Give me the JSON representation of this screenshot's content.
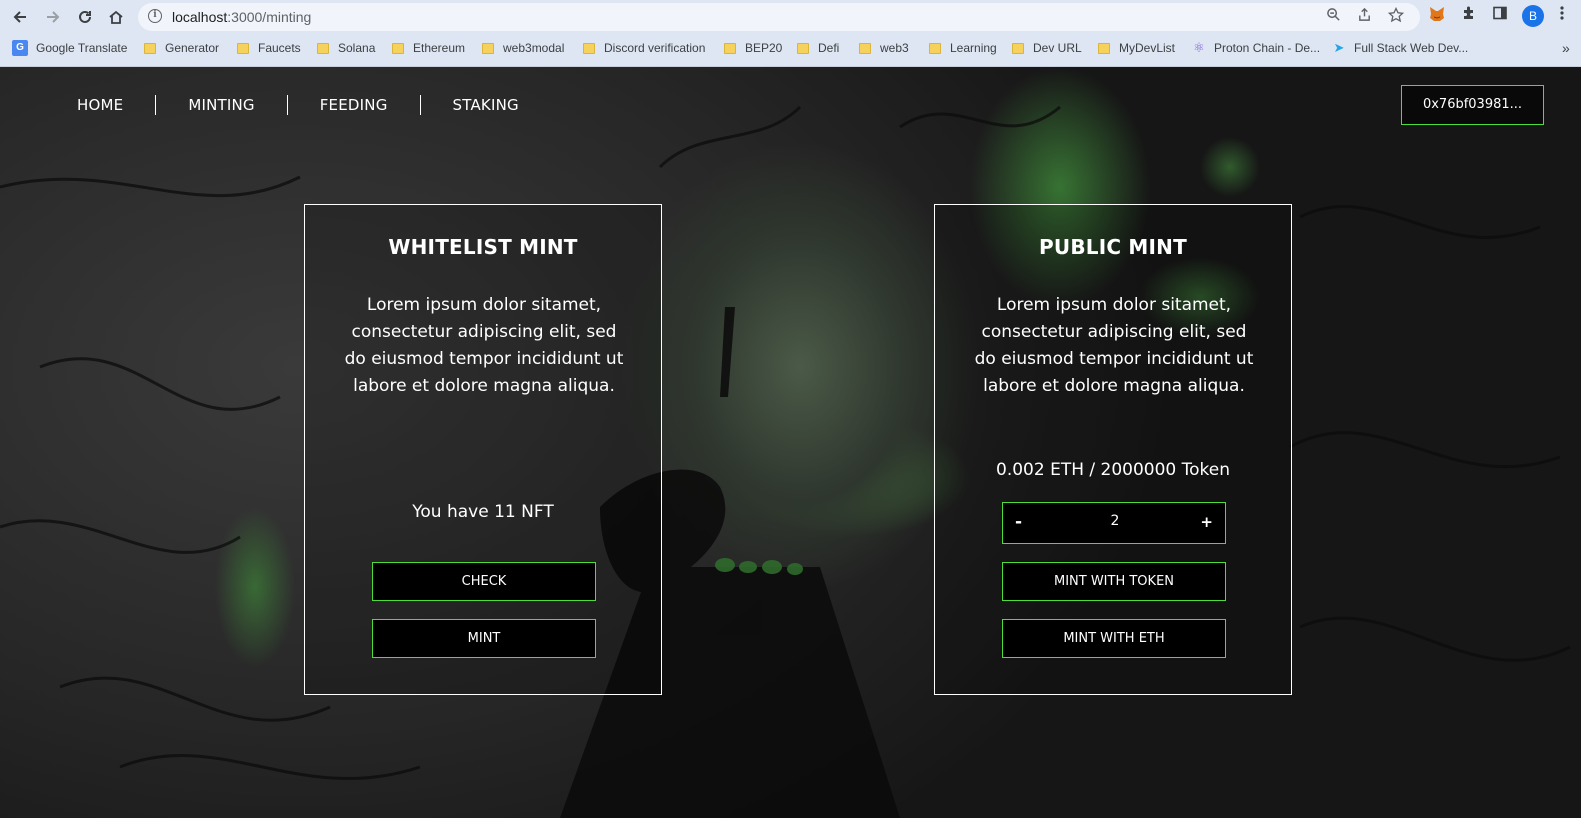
{
  "browser": {
    "url_host": "localhost",
    "url_path": ":3000/minting",
    "profile_initial": "B",
    "bookmarks": [
      {
        "label": "Google Translate",
        "icon": "google-translate-icon"
      },
      {
        "label": "Generator",
        "icon": "folder-icon"
      },
      {
        "label": "Faucets",
        "icon": "folder-icon"
      },
      {
        "label": "Solana",
        "icon": "folder-icon"
      },
      {
        "label": "Ethereum",
        "icon": "folder-icon"
      },
      {
        "label": "web3modal",
        "icon": "folder-icon"
      },
      {
        "label": "Discord verification",
        "icon": "folder-icon"
      },
      {
        "label": "BEP20",
        "icon": "folder-icon"
      },
      {
        "label": "Defi",
        "icon": "folder-icon"
      },
      {
        "label": "web3",
        "icon": "folder-icon"
      },
      {
        "label": "Learning",
        "icon": "folder-icon"
      },
      {
        "label": "Dev URL",
        "icon": "folder-icon"
      },
      {
        "label": "MyDevList",
        "icon": "folder-icon"
      },
      {
        "label": "Proton Chain - De...",
        "icon": "react-icon"
      },
      {
        "label": "Full Stack Web Dev...",
        "icon": "flutter-icon"
      }
    ],
    "overflow_label": "»"
  },
  "nav": {
    "items": [
      "HOME",
      "MINTING",
      "FEEDING",
      "STAKING"
    ]
  },
  "wallet": {
    "address_label": "0x76bf03981..."
  },
  "whitelist": {
    "title": "WHITELIST MINT",
    "description": "Lorem ipsum dolor sitamet, consectetur adipiscing elit, sed do eiusmod tempor incididunt ut labore et dolore magna aliqua.",
    "nft_status": "You have 11 NFT",
    "check_label": "CHECK",
    "mint_label": "MINT"
  },
  "public": {
    "title": "PUBLIC MINT",
    "description": "Lorem ipsum dolor sitamet, consectetur adipiscing elit, sed do eiusmod tempor incididunt ut labore et dolore magna aliqua.",
    "price": "0.002 ETH / 2000000 Token",
    "quantity": "2",
    "minus_label": "-",
    "plus_label": "+",
    "mint_token_label": "MINT WITH TOKEN",
    "mint_eth_label": "MINT WITH ETH"
  },
  "colors": {
    "accent_green": "#4ddc3c",
    "card_border": "#ffffff",
    "button_bg": "#000000"
  }
}
